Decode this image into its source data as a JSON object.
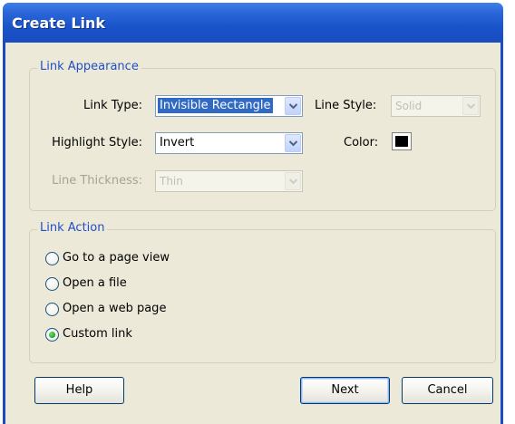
{
  "window": {
    "title": "Create Link"
  },
  "appearance": {
    "legend": "Link Appearance",
    "link_type": {
      "label": "Link Type:",
      "value": "Invisible Rectangle"
    },
    "line_style": {
      "label": "Line Style:",
      "value": "Solid"
    },
    "highlight_style": {
      "label": "Highlight Style:",
      "value": "Invert"
    },
    "color": {
      "label": "Color:",
      "value": "#000000"
    },
    "line_thickness": {
      "label": "Line Thickness:",
      "value": "Thin"
    }
  },
  "action": {
    "legend": "Link Action",
    "options": [
      {
        "label": "Go to a page view",
        "checked": false
      },
      {
        "label": "Open a file",
        "checked": false
      },
      {
        "label": "Open a web page",
        "checked": false
      },
      {
        "label": "Custom link",
        "checked": true
      }
    ]
  },
  "buttons": {
    "help": "Help",
    "next": "Next",
    "cancel": "Cancel"
  }
}
